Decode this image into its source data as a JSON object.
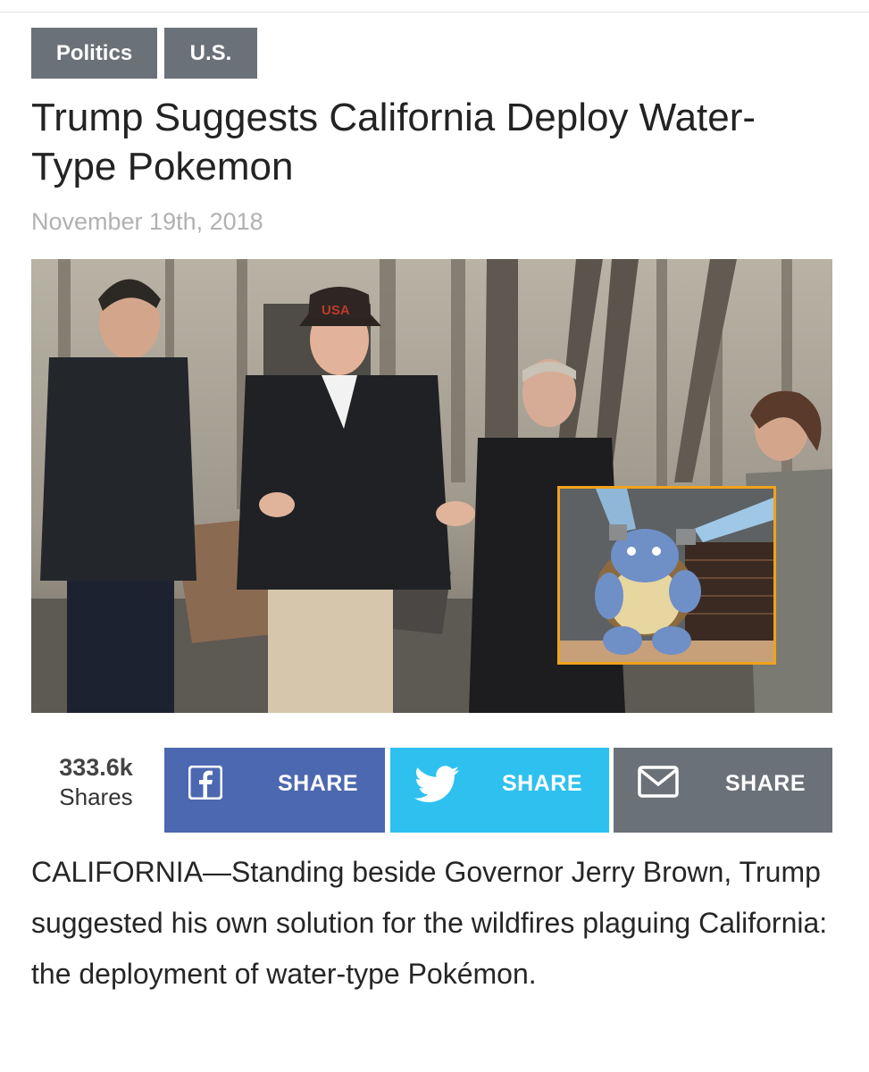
{
  "tags": [
    "Politics",
    "U.S."
  ],
  "headline": "Trump Suggests California Deploy Water-Type Pokemon",
  "date": "November 19th, 2018",
  "photo": {
    "cap_text": "USA",
    "inset_border_color": "#f0a21b"
  },
  "share": {
    "count": "333.6k",
    "count_label": "Shares",
    "facebook_label": "SHARE",
    "twitter_label": "SHARE",
    "email_label": "SHARE",
    "colors": {
      "facebook": "#4c68b0",
      "twitter": "#2ec1f0",
      "email": "#6b7179"
    },
    "icons": [
      "facebook-icon",
      "twitter-icon",
      "mail-icon"
    ]
  },
  "body": "CALIFORNIA—Standing beside Governor Jerry Brown, Trump suggested his own solution for the wildfires plaguing California: the deployment of water-type Pokémon."
}
